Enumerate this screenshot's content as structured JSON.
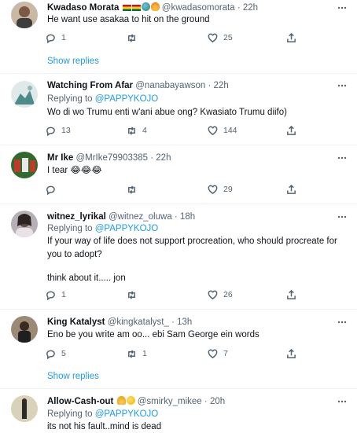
{
  "colors": {
    "accent": "#1d9bf0",
    "text": "#0f1419",
    "muted": "#536471",
    "divider": "#eff3f4"
  },
  "tweets": [
    {
      "name": "Kwadaso Morata",
      "handle": "@kwadasomorata",
      "time": "22h",
      "replying": "",
      "text": "He want use asakaa to hit on the ground",
      "replies": "1",
      "retweets": "",
      "likes": "25",
      "show_replies": "Show replies"
    },
    {
      "name": "Watching From Afar",
      "handle": "@nanabayawson",
      "time": "22h",
      "replying_prefix": "Replying to",
      "replying": "@PAPPYKOJO",
      "text": "Wo di wo Trumu enti w'ani abue ong? Kwasiato Trumu diifo)",
      "replies": "13",
      "retweets": "4",
      "likes": "144"
    },
    {
      "name": "Mr Ike",
      "handle": "@MrIke79903385",
      "time": "22h",
      "text": "I tear 😂😂😂",
      "replies": "",
      "retweets": "",
      "likes": "29"
    },
    {
      "name": "witnez_lyrikal",
      "handle": "@witnez_oluwa",
      "time": "18h",
      "replying_prefix": "Replying to",
      "replying": "@PAPPYKOJO",
      "text_line1": "If your way of life does not support procreation, who should procreate for",
      "text_line2": "you to adopt?",
      "text_line3": "think about it..... jon",
      "replies": "1",
      "retweets": "",
      "likes": "26"
    },
    {
      "name": "King Katalyst",
      "handle": "@kingkatalyst_",
      "time": "13h",
      "text": "Eno be you write am oo... ebi Sam George ein words",
      "replies": "5",
      "retweets": "1",
      "likes": "7",
      "show_replies": "Show replies"
    },
    {
      "name": "Allow-Cash-out",
      "handle": "@smirky_mikee",
      "time": "20h",
      "replying_prefix": "Replying to",
      "replying": "@PAPPYKOJO",
      "text": "its not his fault..mind is dead"
    }
  ]
}
